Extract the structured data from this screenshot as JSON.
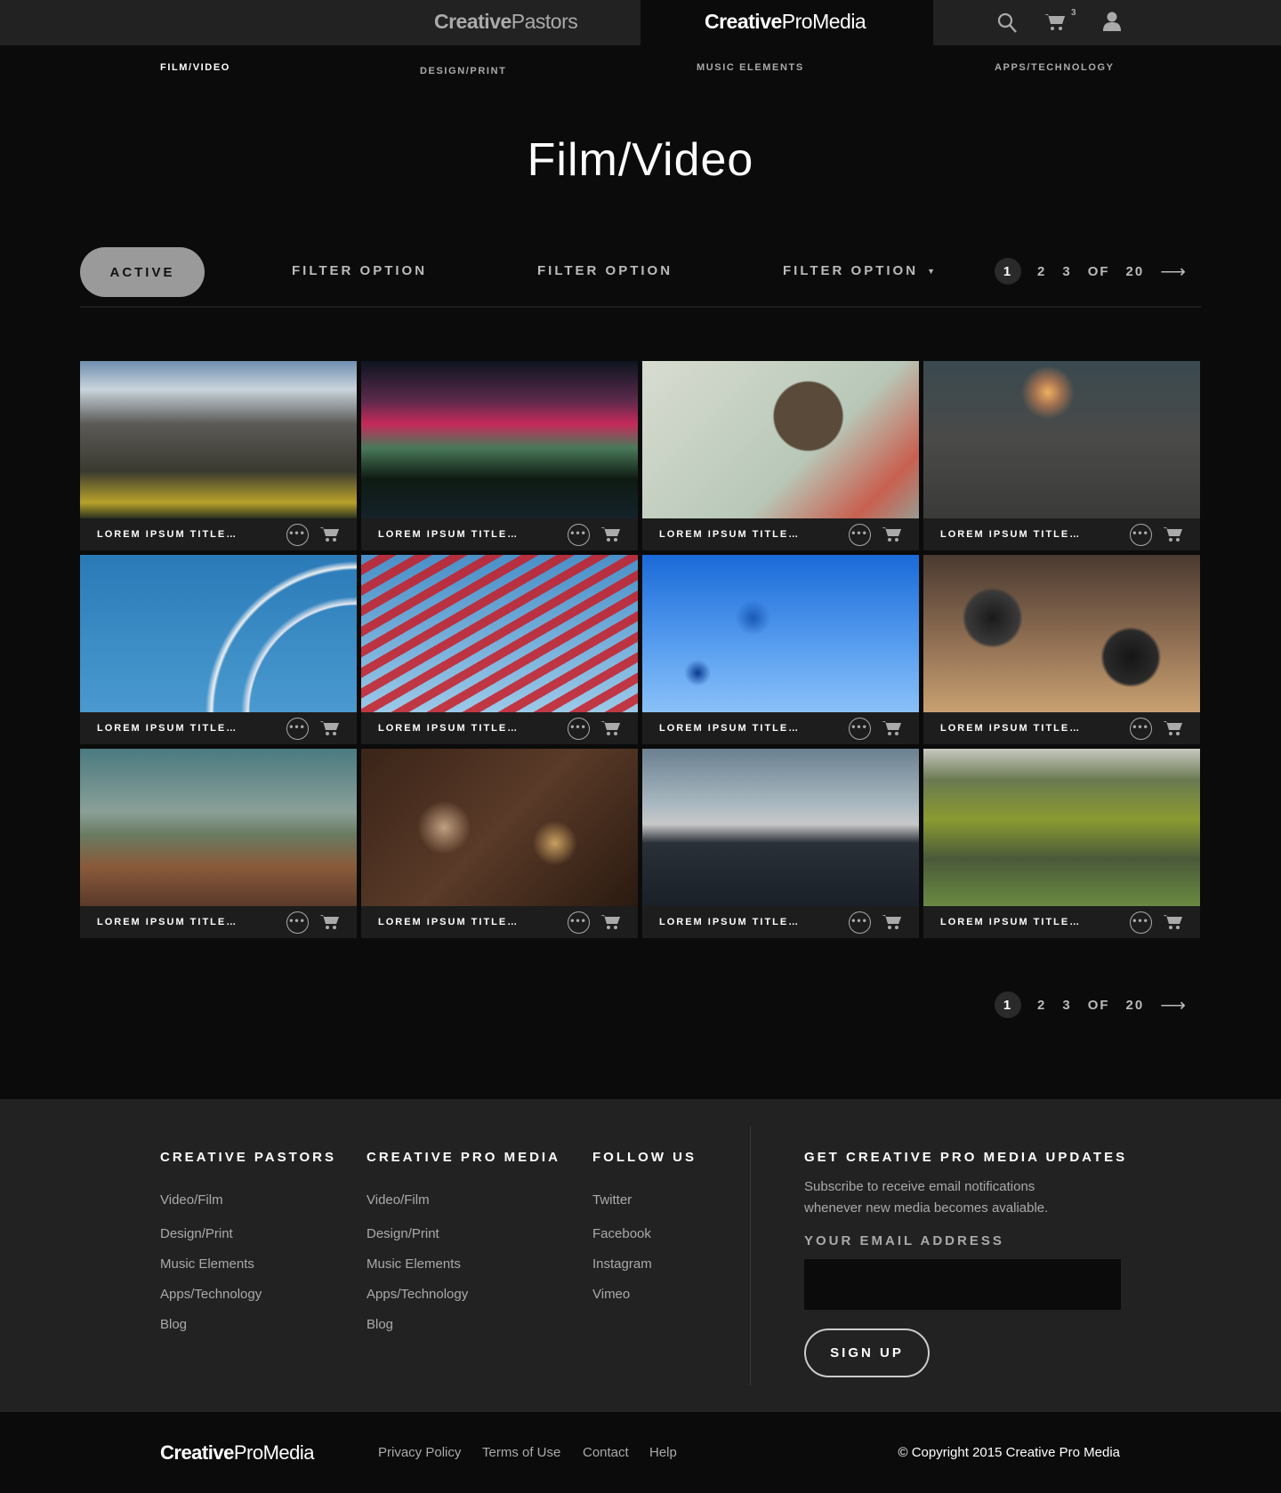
{
  "header": {
    "logo_left": {
      "bold": "Creative",
      "light": "Pastors"
    },
    "logo_center": {
      "bold": "Creative",
      "light": "ProMedia"
    },
    "cart_count": "3"
  },
  "nav": [
    "FILM/VIDEO",
    "DESIGN/PRINT",
    "MUSIC ELEMENTS",
    "APPS/TECHNOLOGY"
  ],
  "page_title": "Film/Video",
  "filters": {
    "active": "ACTIVE",
    "options": [
      "FILTER OPTION",
      "FILTER OPTION",
      "FILTER OPTION"
    ]
  },
  "pagination": {
    "current": "1",
    "pages": [
      "2",
      "3"
    ],
    "of": "OF",
    "total": "20"
  },
  "tiles": [
    {
      "title": "LOREM IPSUM TITLE…",
      "bg": "linear-gradient(180deg,#6f8fb0 0%,#c9d4dc 18%,#5b5a57 40%,#3a3a30 70%,#b9a22a 90%,#2a3020 100%)"
    },
    {
      "title": "LOREM IPSUM TITLE…",
      "bg": "linear-gradient(180deg,#0d1420 0%,#5a2a4a 25%,#c52a5a 40%,#4a7a5a 55%,#0e1a12 75%,#15222a 100%)"
    },
    {
      "title": "LOREM IPSUM TITLE…",
      "bg": "radial-gradient(circle at 60% 35%,#5a4a3a 0,#5a4a3a 38px,transparent 40px),linear-gradient(135deg,#d8dcd0,#b8c8b8 60%,#c86050 85%,#9a9a90)"
    },
    {
      "title": "LOREM IPSUM TITLE…",
      "bg": "radial-gradient(circle at 45% 20%,#f0b060 0,#a07050 15px,transparent 30px),linear-gradient(180deg,#3a4a50,#4a4a48 50%,#3a3a38)"
    },
    {
      "title": "LOREM IPSUM TITLE…",
      "bg": "radial-gradient(circle at 100% 100%,transparent 0,transparent 120px,#e8e8f0 122px,transparent 130px,transparent 160px,#f0f0f0 163px,transparent 170px),linear-gradient(180deg,#2a7ab8,#4a9ad0)"
    },
    {
      "title": "LOREM IPSUM TITLE…",
      "bg": "repeating-linear-gradient(150deg,transparent 0,transparent 10px,rgba(200,30,40,.85) 10px,rgba(200,30,40,.85) 20px),linear-gradient(180deg,#4a90c8,#9ac8e8)"
    },
    {
      "title": "LOREM IPSUM TITLE…",
      "bg": "radial-gradient(circle at 40% 40%,#1a5ab8 0,transparent 20px),radial-gradient(circle at 20% 75%,#0a3a90 0,transparent 15px),linear-gradient(180deg,#1a6ad8,#5aa0f0 60%,#8ac0f8)"
    },
    {
      "title": "LOREM IPSUM TITLE…",
      "bg": "radial-gradient(circle at 25% 40%,#1a1a1a 0,#3a3a3a 30px,transparent 34px),radial-gradient(circle at 75% 65%,#151515 0,#2a2a2a 30px,transparent 34px),linear-gradient(180deg,#4a3a30,#8a6a50 50%,#c8a070)"
    },
    {
      "title": "LOREM IPSUM TITLE…",
      "bg": "linear-gradient(180deg,#4a7a80 0%,#8aa098 40%,#6a7a60 55%,#8a5a3a 75%,#5a3a2a 100%)"
    },
    {
      "title": "LOREM IPSUM TITLE…",
      "bg": "radial-gradient(circle at 30% 50%,#c0a080 0,transparent 30px),radial-gradient(circle at 70% 60%,#c8a060 0,transparent 25px),linear-gradient(135deg,#3a2418,#5a3a28 50%,#2a1a10)"
    },
    {
      "title": "LOREM IPSUM TITLE…",
      "bg": "linear-gradient(180deg,#6a8090 0%,#a8b8c0 35%,#c8c8c8 48%,#2a3038 60%,#1a2028 100%)"
    },
    {
      "title": "LOREM IPSUM TITLE…",
      "bg": "linear-gradient(180deg,#c8c8c0 0%,#6a7a50 20%,#8a9a30 45%,#4a5a3a 70%,#6a8a40 100%)"
    }
  ],
  "footer": {
    "columns": [
      {
        "heading": "CREATIVE PASTORS",
        "links": [
          "Video/Film",
          "Design/Print",
          "Music Elements",
          "Apps/Technology",
          "Blog"
        ]
      },
      {
        "heading": "CREATIVE PRO MEDIA",
        "links": [
          "Video/Film",
          "Design/Print",
          "Music Elements",
          "Apps/Technology",
          "Blog"
        ]
      },
      {
        "heading": "FOLLOW US",
        "links": [
          "Twitter",
          "Facebook",
          "Instagram",
          "Vimeo"
        ]
      }
    ],
    "updates": {
      "heading": "GET CREATIVE PRO MEDIA UPDATES",
      "line1": "Subscribe to receive email notifications",
      "line2": "whenever new media becomes avaliable.",
      "email_label": "YOUR EMAIL ADDRESS",
      "email_value": "",
      "signup": "SIGN UP"
    }
  },
  "bottom": {
    "logo": {
      "bold": "Creative",
      "light": "ProMedia"
    },
    "links": [
      "Privacy Policy",
      "Terms of Use",
      "Contact",
      "Help"
    ],
    "copyright": "© Copyright 2015 Creative Pro Media"
  }
}
